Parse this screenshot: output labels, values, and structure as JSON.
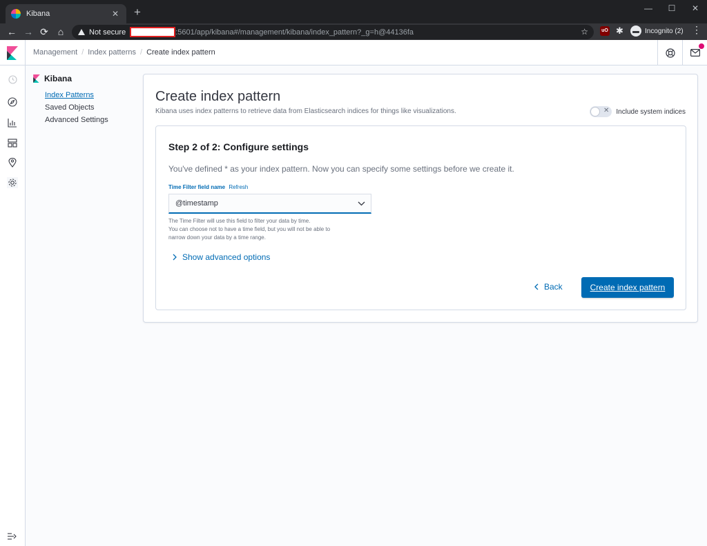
{
  "browser": {
    "tab_title": "Kibana",
    "tab_close": "✕",
    "new_tab": "+",
    "window_controls": [
      "—",
      "☐",
      "✕"
    ],
    "security_label": "Not secure",
    "url": ":5601/app/kibana#/management/kibana/index_pattern?_g=h@44136fa",
    "incognito_label": "Incognito (2)",
    "ublock_label": "uO",
    "icons": {
      "back": "←",
      "forward": "→",
      "reload": "⟳",
      "home": "⌂",
      "star": "☆",
      "puzzle": "✱",
      "menu": "⋮"
    }
  },
  "kibana": {
    "breadcrumbs": [
      "Management",
      "Index patterns",
      "Create index pattern"
    ],
    "sidebar": {
      "title": "Kibana",
      "items": [
        {
          "label": "Index Patterns",
          "active": true
        },
        {
          "label": "Saved Objects",
          "active": false
        },
        {
          "label": "Advanced Settings",
          "active": false
        }
      ]
    },
    "panel": {
      "title": "Create index pattern",
      "description": "Kibana uses index patterns to retrieve data from Elasticsearch indices for things like visualizations.",
      "toggle_label": "Include system indices",
      "toggle_on": false
    },
    "step": {
      "title": "Step 2 of 2: Configure settings",
      "description": "You've defined * as your index pattern. Now you can specify some settings before we create it.",
      "field_label": "Time Filter field name",
      "refresh_label": "Refresh",
      "selected_value": "@timestamp",
      "help_lines": [
        "The Time Filter will use this field to filter your data by time.",
        "You can choose not to have a time field, but you will not be able to",
        "narrow down your data by a time range."
      ],
      "advanced_label": "Show advanced options",
      "back_label": "Back",
      "create_label": "Create index pattern"
    },
    "colors": {
      "primary": "#006bb4",
      "badge": "#dd0a73"
    }
  }
}
